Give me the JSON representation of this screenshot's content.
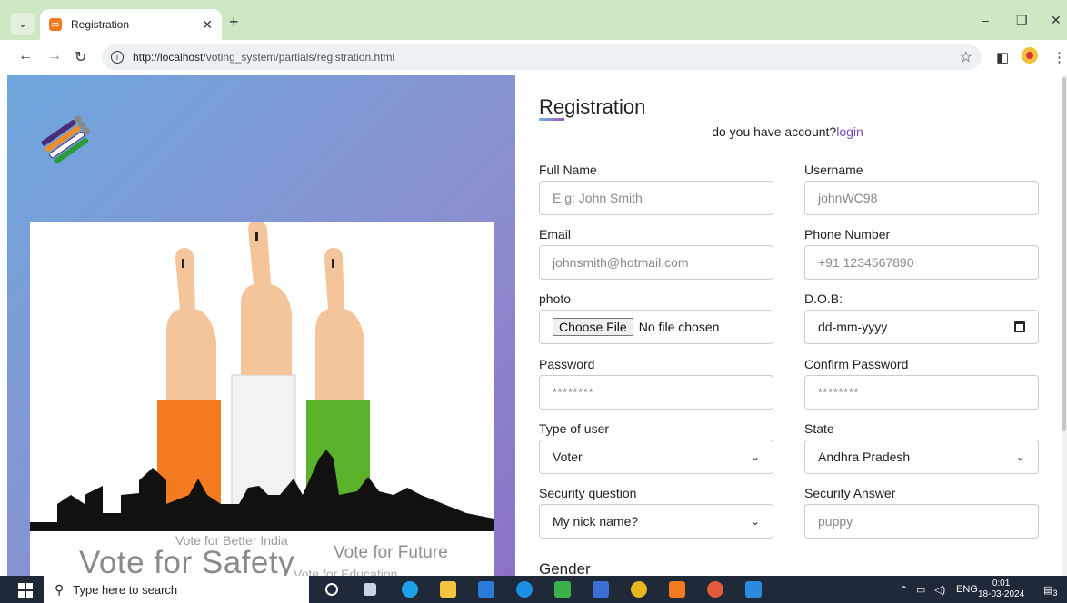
{
  "browser": {
    "tab_title": "Registration",
    "tab_favicon": "xampp-icon",
    "url_host": "http://localhost",
    "url_path": "/voting_system/partials/registration.html"
  },
  "form": {
    "title": "Registration",
    "account_prompt": "do you have account?",
    "login_link": "login",
    "fields": {
      "full_name": {
        "label": "Full Name",
        "placeholder": "E.g: John Smith"
      },
      "username": {
        "label": "Username",
        "placeholder": "johnWC98"
      },
      "email": {
        "label": "Email",
        "placeholder": "johnsmith@hotmail.com"
      },
      "phone": {
        "label": "Phone Number",
        "placeholder": "+91 1234567890"
      },
      "photo": {
        "label": "photo",
        "button": "Choose File",
        "status": "No file chosen"
      },
      "dob": {
        "label": "D.O.B:",
        "placeholder": "dd-mm-yyyy"
      },
      "password": {
        "label": "Password",
        "placeholder": "********"
      },
      "confirm_password": {
        "label": "Confirm Password",
        "placeholder": "********"
      },
      "user_type": {
        "label": "Type of user",
        "value": "Voter"
      },
      "state": {
        "label": "State",
        "value": "Andhra Pradesh"
      },
      "security_question": {
        "label": "Security question",
        "value": "My nick name?"
      },
      "security_answer": {
        "label": "Security Answer",
        "placeholder": "puppy"
      }
    },
    "gender_label": "Gender"
  },
  "poster": {
    "tag_better_india": "Vote for Better India",
    "tag_safety": "Vote for Safety",
    "tag_future": "Vote for Future",
    "tag_education": "Vote for Education"
  },
  "taskbar": {
    "search_placeholder": "Type here to search",
    "language": "ENG",
    "time": "0:01",
    "date": "18-03-2024",
    "notification_count": "3"
  }
}
